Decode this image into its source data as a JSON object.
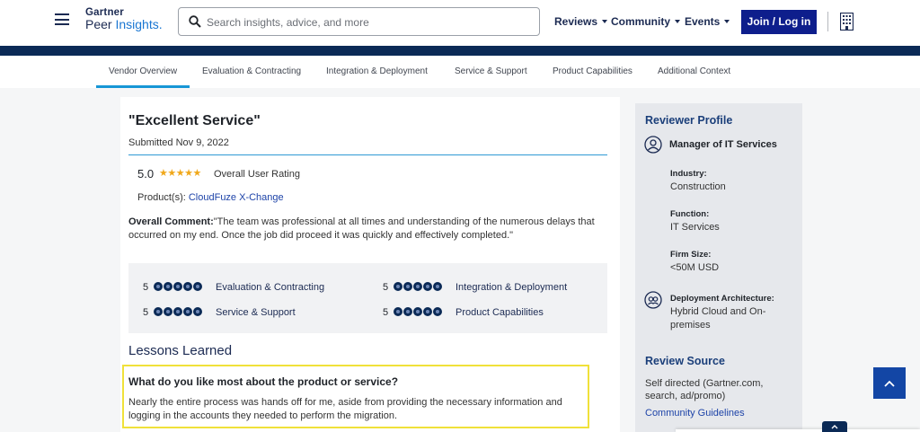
{
  "header": {
    "logo_line1": "Gartner",
    "logo_line2_a": "Peer ",
    "logo_line2_b": "Insights",
    "logo_line2_c": ".",
    "search_placeholder": "Search insights, advice, and more",
    "nav": [
      "Reviews",
      "Community",
      "Events"
    ],
    "join_label": "Join / Log in",
    "icons": [
      "menu-icon",
      "search-icon",
      "building-icon"
    ]
  },
  "subnav": {
    "tabs": [
      "Vendor Overview",
      "Evaluation & Contracting",
      "Integration & Deployment",
      "Service & Support",
      "Product Capabilities",
      "Additional Context"
    ],
    "active_index": 0
  },
  "review": {
    "title": "\"Excellent Service\"",
    "submitted": "Submitted Nov 9, 2022",
    "rating": "5.0",
    "stars": "★★★★★",
    "rating_label": "Overall User Rating",
    "product_label": "Product(s): ",
    "product_name": "CloudFuze X-Change",
    "comment_label": "Overall Comment:",
    "comment_text": "\"The team was professional at all times and understanding of the numerous delays that occurred on my end. Once the job did proceed it was quickly and effectively completed.\"",
    "scores": [
      {
        "value": "5",
        "name": "Evaluation & Contracting"
      },
      {
        "value": "5",
        "name": "Integration & Deployment"
      },
      {
        "value": "5",
        "name": "Service & Support"
      },
      {
        "value": "5",
        "name": "Product Capabilities"
      }
    ],
    "lessons_heading": "Lessons Learned",
    "question": "What do you like most about the product or service?",
    "answer": "Nearly the entire process was hands off for me, aside from providing the necessary information and logging in the accounts they needed to perform the migration."
  },
  "profile": {
    "title": "Reviewer Profile",
    "role": "Manager of IT Services",
    "industry_label": "Industry:",
    "industry": "Construction",
    "function_label": "Function:",
    "function": "IT Services",
    "firm_size_label": "Firm Size:",
    "firm_size": "<50M USD",
    "deployment_label": "Deployment Architecture:",
    "deployment_line1": "Hybrid Cloud and On-",
    "deployment_line2": "premises",
    "source_title": "Review Source",
    "source_line1": "Self directed (Gartner.com,",
    "source_line2": "search, ad/promo)",
    "guidelines_link": "Community Guidelines"
  },
  "colors": {
    "brand_navy": "#0b2a56",
    "join_button": "#0e1e8c",
    "accent_blue": "#1796d6",
    "star_gold": "#f0a81b",
    "highlight_yellow": "#f0e13a"
  }
}
